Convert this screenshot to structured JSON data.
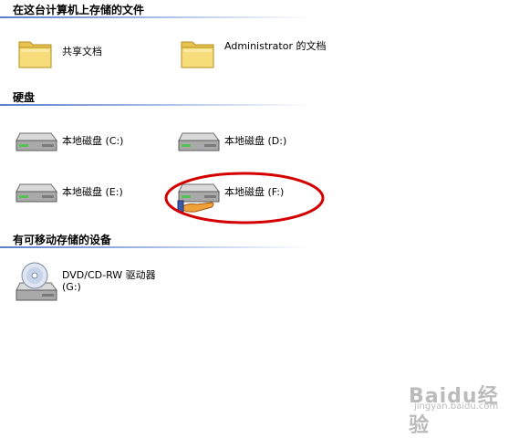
{
  "groups": {
    "stored_files": {
      "title": "在这台计算机上存储的文件",
      "items": [
        {
          "label": "共享文档",
          "icon": "folder-icon"
        },
        {
          "label": "Administrator 的文档",
          "icon": "folder-icon"
        }
      ]
    },
    "hard_disks": {
      "title": "硬盘",
      "items": [
        {
          "label": "本地磁盘 (C:)",
          "icon": "hard-drive-icon"
        },
        {
          "label": "本地磁盘 (D:)",
          "icon": "hard-drive-icon"
        },
        {
          "label": "本地磁盘 (E:)",
          "icon": "hard-drive-icon"
        },
        {
          "label": "本地磁盘 (F:)",
          "icon": "shared-hard-drive-icon"
        }
      ]
    },
    "removable": {
      "title": "有可移动存储的设备",
      "items": [
        {
          "label": "DVD/CD-RW 驱动器 (G:)",
          "icon": "dvd-drive-icon"
        }
      ]
    }
  },
  "watermark": {
    "brand": "Baidu经验",
    "sub": "jingyan.baidu.com"
  },
  "colors": {
    "header_line": "#5a7fc9",
    "annotation": "#d40000",
    "folder": "#f2d36b",
    "drive": "#9a9a9a"
  }
}
